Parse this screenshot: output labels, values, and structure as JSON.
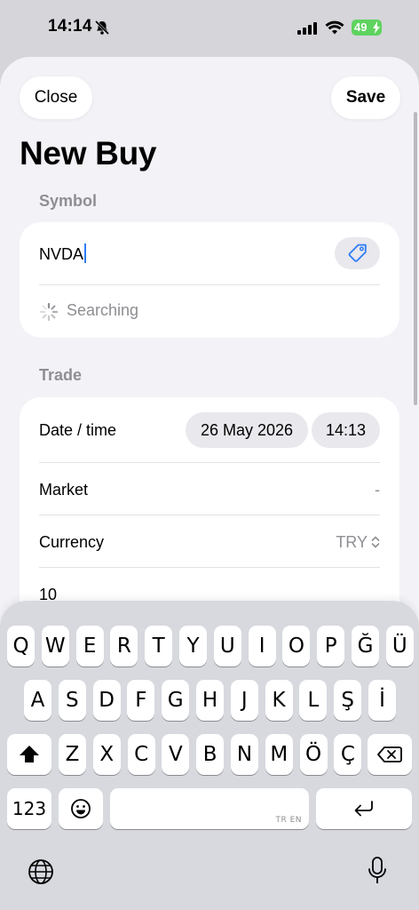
{
  "status_bar": {
    "time": "14:14",
    "battery": "49"
  },
  "header": {
    "close_label": "Close",
    "save_label": "Save",
    "title": "New Buy"
  },
  "symbol_section": {
    "label": "Symbol",
    "input_value": "NVDA",
    "searching_text": "Searching"
  },
  "trade_section": {
    "label": "Trade",
    "date_time_label": "Date / time",
    "date_value": "26 May 2026",
    "time_value": "14:13",
    "market_label": "Market",
    "market_value": "-",
    "currency_label": "Currency",
    "currency_value": "TRY",
    "quantity_value": "10"
  },
  "keyboard": {
    "row1": [
      "Q",
      "W",
      "E",
      "R",
      "T",
      "Y",
      "U",
      "I",
      "O",
      "P",
      "Ğ",
      "Ü"
    ],
    "row2": [
      "A",
      "S",
      "D",
      "F",
      "G",
      "H",
      "J",
      "K",
      "L",
      "Ş",
      "İ"
    ],
    "row3": [
      "Z",
      "X",
      "C",
      "V",
      "B",
      "N",
      "M",
      "Ö",
      "Ç"
    ],
    "numbers_label": "123",
    "space_lang": "TR EN"
  },
  "colors": {
    "accent": "#2f7cf6",
    "battery": "#5fd35f",
    "sheet_bg": "#f2f2f7"
  }
}
